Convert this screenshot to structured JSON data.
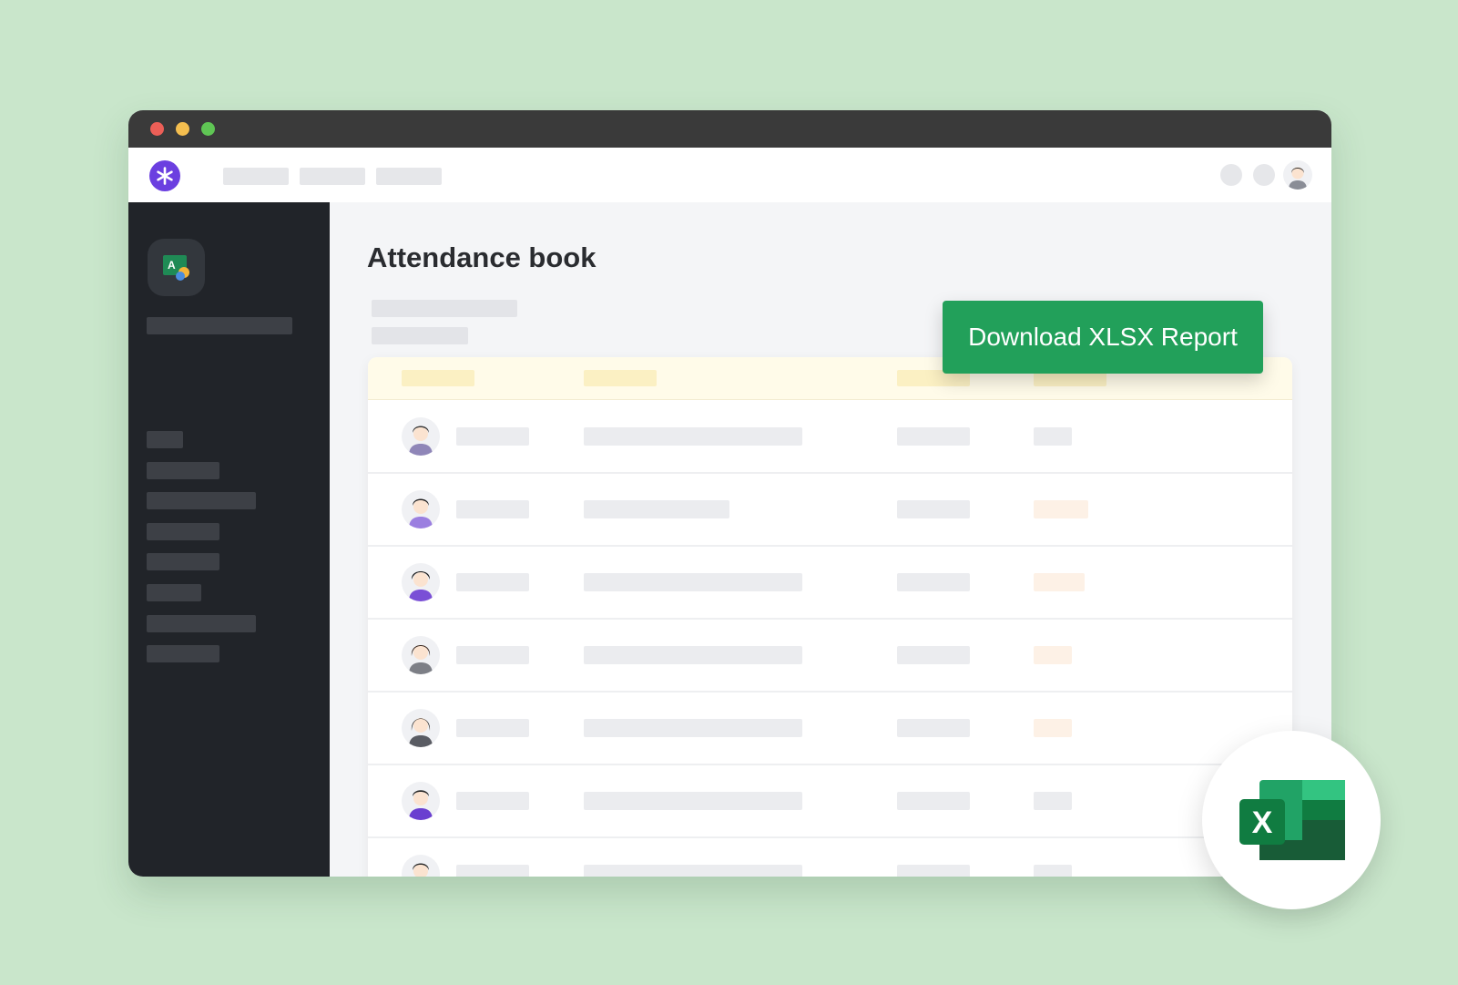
{
  "page": {
    "title": "Attendance book"
  },
  "actions": {
    "download_label": "Download XLSX Report"
  },
  "excel_badge": {
    "letter": "X"
  },
  "colors": {
    "background": "#c9e6cb",
    "brand_purple": "#6b3fe0",
    "sidebar": "#212429",
    "download_green": "#22a05a",
    "excel_green": "#1e7145"
  },
  "icons": {
    "logo": "asterisk-logo-icon",
    "app": "attendance-app-icon",
    "excel": "excel-icon"
  }
}
